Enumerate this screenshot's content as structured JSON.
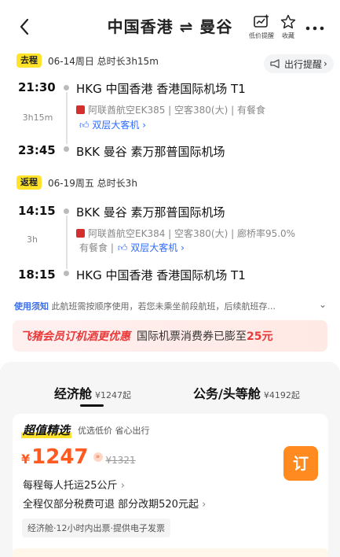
{
  "header": {
    "title": "中国香港 ⇌ 曼谷",
    "price_alert_label": "低价提醒",
    "favorite_label": "收藏"
  },
  "outbound": {
    "tag": "去程",
    "date_info": "06-14周日 总时长3h15m",
    "reminder": "出行提醒",
    "dep_time": "21:30",
    "dep_airport": "HKG 中国香港 香港国际机场 T1",
    "duration": "3h15m",
    "airline_info": "阿联酋航空EK385 | 空客380(大) | 有餐食",
    "aircraft_badge": "双层大客机",
    "arr_time": "23:45",
    "arr_airport": "BKK 曼谷 素万那普国际机场"
  },
  "return": {
    "tag": "返程",
    "date_info": "06-19周五 总时长3h",
    "dep_time": "14:15",
    "dep_airport": "BKK 曼谷 素万那普国际机场",
    "duration": "3h",
    "airline_info": "阿联酋航空EK384 | 空客380(大) | 廊桥率95.0%",
    "meal": "有餐食 |",
    "aircraft_badge": "双层大客机",
    "arr_time": "18:15",
    "arr_airport": "HKG 中国香港 香港国际机场 T1"
  },
  "notice": {
    "label": "使用须知",
    "text": "此航班需按顺序使用，若您未乘坐前段航班，后续航班存..."
  },
  "promo": {
    "highlight": "飞猪会员订机酒更优惠",
    "text": "国际机票消费券已膨至",
    "amount": "25元"
  },
  "cabins": {
    "economy_label": "经济舱",
    "economy_price": "¥1247起",
    "business_label": "公务/头等舱",
    "business_price": "¥4192起"
  },
  "offer": {
    "title": "超值精选",
    "slogan": "优选低价 省心出行",
    "currency": "¥",
    "price": "1247",
    "original_price": "¥1321",
    "baggage": "每程每人托运25公斤",
    "refund": "全程仅部分税费可退 部分改期520元起",
    "chip": "经济舱·12小时内出票·提供电子发票",
    "book_label": "订"
  },
  "colors": {
    "accent_orange": "#ff5a1f",
    "tag_yellow": "#ffe32a",
    "link_blue": "#2f6bff",
    "promo_red": "#e83a3a"
  }
}
